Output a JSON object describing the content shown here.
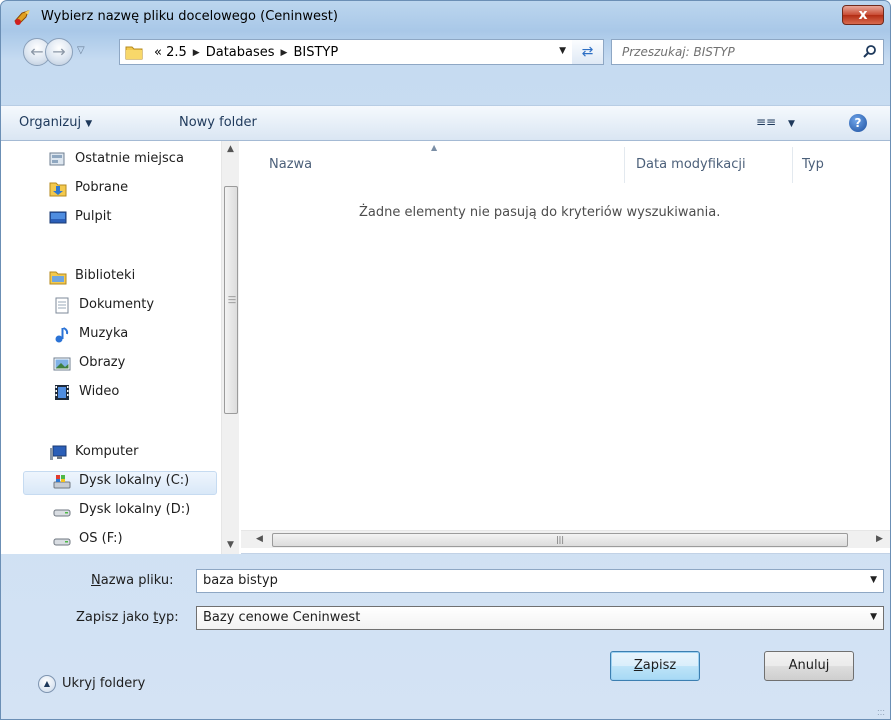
{
  "window": {
    "title": "Wybierz nazwę pliku docelowego (Ceninwest)",
    "close_label": "x"
  },
  "address": {
    "overflow": "«",
    "crumbs": [
      "2.5",
      "Databases",
      "BISTYP"
    ],
    "search_placeholder": "Przeszukaj: BISTYP"
  },
  "toolbar": {
    "organize_label": "Organizuj",
    "new_folder_label": "Nowy folder",
    "help_label": "?"
  },
  "nav_pane": {
    "items": [
      {
        "label": "Ostatnie miejsca",
        "icon": "recent-places-icon"
      },
      {
        "label": "Pobrane",
        "icon": "downloads-folder-icon"
      },
      {
        "label": "Pulpit",
        "icon": "desktop-icon"
      },
      {
        "label": "Biblioteki",
        "icon": "libraries-icon"
      },
      {
        "label": "Dokumenty",
        "icon": "documents-icon"
      },
      {
        "label": "Muzyka",
        "icon": "music-icon"
      },
      {
        "label": "Obrazy",
        "icon": "pictures-icon"
      },
      {
        "label": "Wideo",
        "icon": "video-icon"
      },
      {
        "label": "Komputer",
        "icon": "computer-icon"
      },
      {
        "label": "Dysk lokalny (C:)",
        "icon": "drive-c-icon",
        "selected": true
      },
      {
        "label": "Dysk lokalny (D:)",
        "icon": "drive-icon"
      },
      {
        "label": "OS (F:)",
        "icon": "drive-icon"
      }
    ]
  },
  "file_list": {
    "columns": [
      "Nazwa",
      "Data modyfikacji",
      "Typ"
    ],
    "empty_message": "Żadne elementy nie pasują do kryteriów wyszukiwania."
  },
  "form": {
    "filename_label_u": "N",
    "filename_label_rest": "azwa pliku:",
    "filename_value": "baza bistyp",
    "type_label_pre": "Zapisz jako ",
    "type_label_u": "t",
    "type_label_post": "yp:",
    "type_value": "Bazy cenowe Ceninwest"
  },
  "footer": {
    "hide_folders_label": "Ukryj foldery",
    "save_u": "Z",
    "save_rest": "apisz",
    "cancel_label": "Anuluj"
  },
  "colors": {
    "accent": "#3c7fb1",
    "close_button": "#c84a32",
    "frame": "#a9c8e8"
  }
}
